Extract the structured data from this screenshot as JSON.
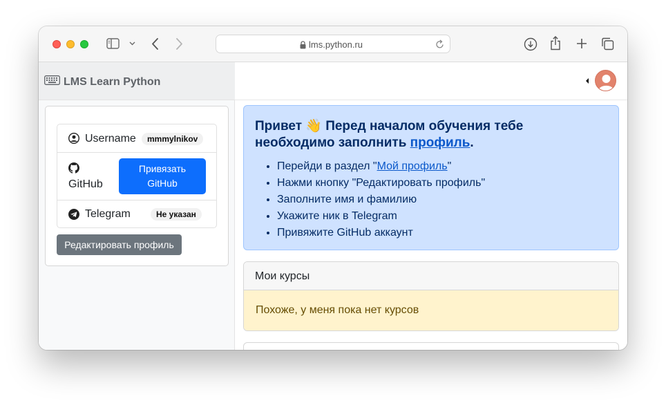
{
  "browser": {
    "url": "lms.python.ru"
  },
  "sidebar": {
    "brand": "LMS Learn Python",
    "profile": {
      "username_label": "Username",
      "username_value": "mmmylnikov",
      "github_label": "GitHub",
      "github_button_line1": "Привязать",
      "github_button_line2": "GitHub",
      "telegram_label": "Telegram",
      "telegram_value": "Не указан",
      "edit_button": "Редактировать профиль"
    }
  },
  "main": {
    "alert": {
      "title_part1": "Привет 👋 Перед началом обучения тебе необходимо заполнить ",
      "title_link": "профиль",
      "title_end": ".",
      "steps": [
        {
          "prefix": "Перейди в раздел \"",
          "link": "Мой профиль",
          "suffix": "\""
        },
        {
          "text": "Нажми кнопку \"Редактировать профиль\""
        },
        {
          "text": "Заполните имя и фамилию"
        },
        {
          "text": "Укажите ник в Telegram"
        },
        {
          "text": "Привяжите GitHub аккаунт"
        }
      ]
    },
    "courses": {
      "header": "Мои курсы",
      "empty_text": "Похоже, у меня пока нет курсов"
    }
  },
  "colors": {
    "primary": "#0d6efd",
    "secondary": "#6c757d",
    "alert_info_bg": "#cfe2ff",
    "alert_warning_bg": "#fff3cd",
    "avatar": "#e2836c"
  }
}
